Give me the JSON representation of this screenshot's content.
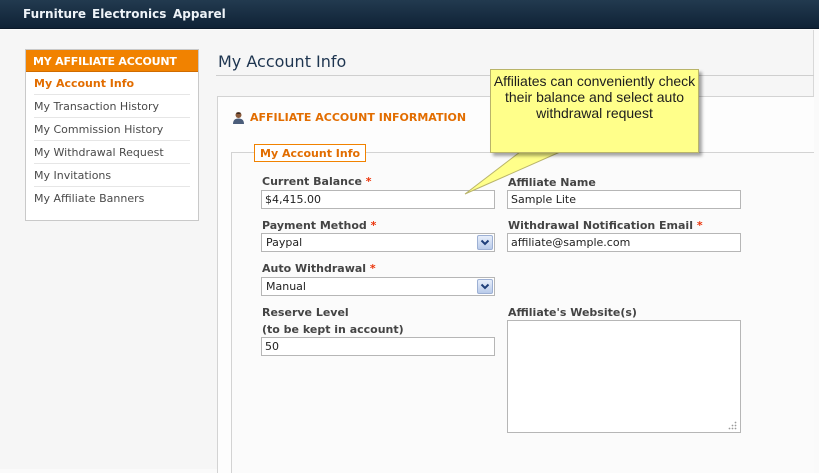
{
  "nav": {
    "items": [
      {
        "label": "Furniture"
      },
      {
        "label": "Electronics"
      },
      {
        "label": "Apparel"
      }
    ]
  },
  "sidebar": {
    "title": "MY AFFILIATE ACCOUNT",
    "items": [
      {
        "label": "My Account Info",
        "active": true
      },
      {
        "label": "My Transaction History"
      },
      {
        "label": "My Commission History"
      },
      {
        "label": "My Withdrawal Request"
      },
      {
        "label": "My Invitations"
      },
      {
        "label": "My Affiliate Banners"
      }
    ]
  },
  "main": {
    "page_title": "My Account Info",
    "section_title": "AFFILIATE ACCOUNT INFORMATION",
    "legend": "My Account Info",
    "fields": {
      "current_balance": {
        "label": "Current Balance",
        "required": "*",
        "value": "$4,415.00"
      },
      "affiliate_name": {
        "label": "Affiliate Name",
        "value": "Sample Lite"
      },
      "payment_method": {
        "label": "Payment Method",
        "required": "*",
        "value": "Paypal"
      },
      "withdrawal_email": {
        "label": "Withdrawal Notification Email",
        "required": "*",
        "value": "affiliate@sample.com"
      },
      "auto_withdrawal": {
        "label": "Auto Withdrawal",
        "required": "*",
        "value": "Manual"
      },
      "reserve_level": {
        "label": "Reserve Level",
        "sublabel": "(to be kept in account)",
        "value": "50"
      },
      "websites": {
        "label": "Affiliate's Website(s)",
        "value": ""
      }
    }
  },
  "callout": {
    "text": "Affiliates can conveniently check their balance and select auto withdrawal request"
  },
  "colors": {
    "nav_bg": "#1a2f45",
    "accent_orange": "#f18200",
    "callout_bg": "#ffff8a"
  },
  "icons": [
    "user-icon",
    "dropdown-arrow-icon",
    "resize-grip-icon"
  ]
}
